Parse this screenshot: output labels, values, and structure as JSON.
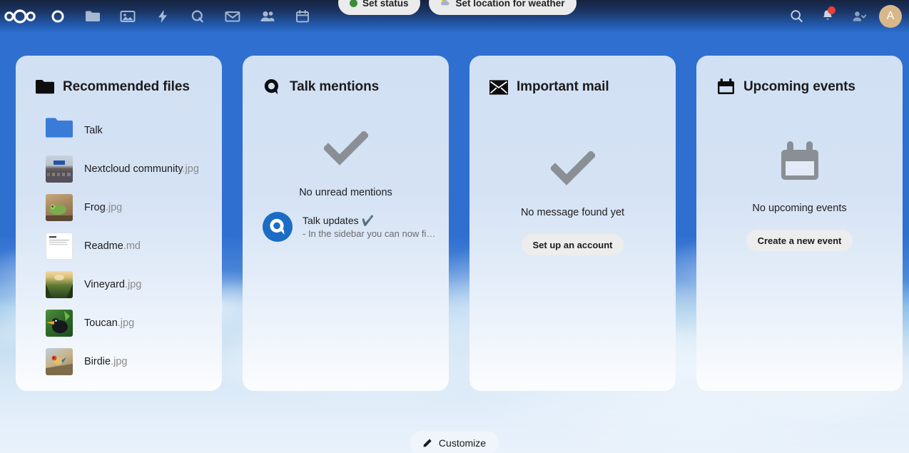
{
  "header": {
    "logo_name": "nextcloud-logo",
    "apps": [
      {
        "id": "dashboard",
        "label": "Dashboard",
        "icon": "dashboard-icon",
        "active": true
      },
      {
        "id": "files",
        "label": "Files",
        "icon": "folder-icon",
        "active": false
      },
      {
        "id": "photos",
        "label": "Photos",
        "icon": "photos-icon",
        "active": false
      },
      {
        "id": "activity",
        "label": "Activity",
        "icon": "lightning-icon",
        "active": false
      },
      {
        "id": "search",
        "label": "Unified search",
        "icon": "magnifier-icon",
        "active": false
      },
      {
        "id": "mail",
        "label": "Mail",
        "icon": "envelope-icon",
        "active": false
      },
      {
        "id": "contacts",
        "label": "Contacts",
        "icon": "contacts-icon",
        "active": false
      },
      {
        "id": "calendar",
        "label": "Calendar",
        "icon": "calendar-icon",
        "active": false
      }
    ],
    "status_buttons": [
      {
        "id": "set-status",
        "label": "Set status",
        "icon": "online-status-dot"
      },
      {
        "id": "set-weather-location",
        "label": "Set location for weather",
        "icon": "weather-icon"
      }
    ],
    "right": {
      "search_icon": "search-icon",
      "notifications_icon": "bell-icon",
      "notifications_has_badge": true,
      "contacts_menu_icon": "contacts-menu-icon",
      "avatar_initial": "A",
      "avatar_color": "#d8b88a"
    }
  },
  "cards": {
    "recommended_files": {
      "title": "Recommended files",
      "icon": "folder-icon",
      "files": [
        {
          "name": "Talk",
          "ext": "",
          "thumb": "folder"
        },
        {
          "name": "Nextcloud community",
          "ext": ".jpg",
          "thumb": "community"
        },
        {
          "name": "Frog",
          "ext": ".jpg",
          "thumb": "frog"
        },
        {
          "name": "Readme",
          "ext": ".md",
          "thumb": "readme"
        },
        {
          "name": "Vineyard",
          "ext": ".jpg",
          "thumb": "vineyard"
        },
        {
          "name": "Toucan",
          "ext": ".jpg",
          "thumb": "toucan"
        },
        {
          "name": "Birdie",
          "ext": ".jpg",
          "thumb": "birdie"
        }
      ]
    },
    "talk_mentions": {
      "title": "Talk mentions",
      "icon": "talk-icon",
      "empty_icon": "checkmark-icon",
      "empty_text": "No unread mentions",
      "item": {
        "avatar_icon": "talk-avatar-icon",
        "title": "Talk updates ✔️",
        "subtitle": "- In the sidebar you can now fi…"
      }
    },
    "important_mail": {
      "title": "Important mail",
      "icon": "envelope-icon",
      "empty_icon": "checkmark-icon",
      "empty_text": "No message found yet",
      "button_label": "Set up an account"
    },
    "upcoming_events": {
      "title": "Upcoming events",
      "icon": "calendar-icon",
      "empty_icon": "calendar-empty-icon",
      "empty_text": "No upcoming events",
      "button_label": "Create a new event"
    }
  },
  "footer": {
    "customize_label": "Customize",
    "customize_icon": "pencil-icon"
  },
  "colors": {
    "primary_blue": "#2f6fd0",
    "card_bg_top": "#d2e0f3",
    "card_bg_bottom": "#fbfdfe",
    "badge_red": "#e8403a",
    "avatar": "#d8b88a",
    "muted_text": "#8a8a8a"
  }
}
